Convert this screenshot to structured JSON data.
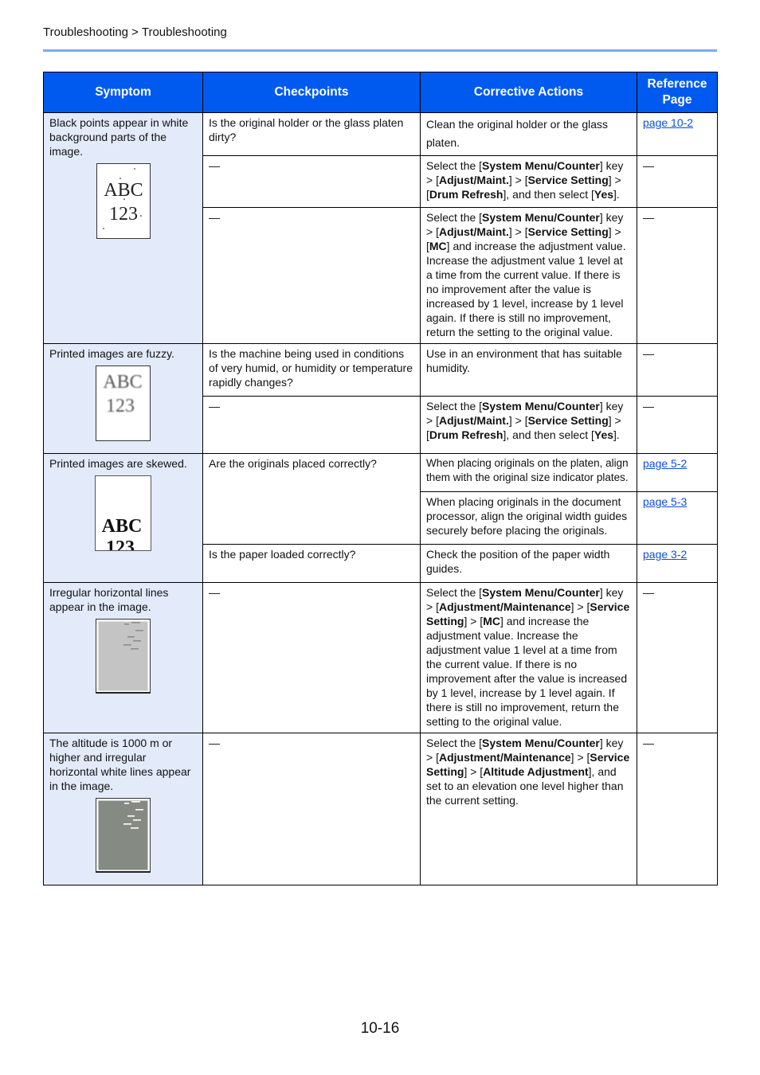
{
  "breadcrumb": "Troubleshooting > Troubleshooting",
  "colors": {
    "header": "#005af0",
    "symptom_bg": "#e3ebfb",
    "rule": "#7ea9f3",
    "link": "#0b4fe0"
  },
  "headers": [
    "Symptom",
    "Checkpoints",
    "Corrective Actions",
    "Reference Page"
  ],
  "symptoms": [
    {
      "text": "Black points appear in white background parts of the image.",
      "image": {
        "type": "black-points",
        "l1": "ABC",
        "l2": "123"
      }
    },
    {
      "text": "Printed images are fuzzy.",
      "image": {
        "type": "fuzzy",
        "l1": "ABC",
        "l2": "123"
      }
    },
    {
      "text": "Printed images are skewed.",
      "image": {
        "type": "skewed",
        "l1": "ABC",
        "l2": "123"
      }
    },
    {
      "text": "Irregular horizontal lines appear in the image.",
      "image": {
        "type": "gray-lines"
      }
    },
    {
      "text": "The altitude is 1000 m or higher and irregular horizontal white lines appear in the image.",
      "image": {
        "type": "dark-white-lines"
      }
    }
  ],
  "checkpoints": [
    "Is the original holder or the glass platen dirty?",
    "—",
    "—",
    "Is the machine being used in conditions of very humid, or humidity or temperature rapidly changes?",
    "—",
    "Are the originals placed correctly?",
    "Is the paper loaded correctly?",
    "—",
    "—"
  ],
  "actions": [
    [
      {
        "t": "Clean the original holder or the glass platen."
      }
    ],
    [
      {
        "t": "Select the ["
      },
      {
        "t": "System Menu/Counter",
        "b": true
      },
      {
        "t": "] key > ["
      },
      {
        "t": "Adjust/Maint.",
        "b": true
      },
      {
        "t": "] > ["
      },
      {
        "t": "Service Setting",
        "b": true
      },
      {
        "t": "] > ["
      },
      {
        "t": "Drum Refresh",
        "b": true
      },
      {
        "t": "], and then select ["
      },
      {
        "t": "Yes",
        "b": true
      },
      {
        "t": "]."
      }
    ],
    [
      {
        "t": "Select the ["
      },
      {
        "t": "System Menu/Counter",
        "b": true
      },
      {
        "t": "] key > ["
      },
      {
        "t": "Adjust/Maint.",
        "b": true
      },
      {
        "t": "] > ["
      },
      {
        "t": "Service Setting",
        "b": true
      },
      {
        "t": "] > ["
      },
      {
        "t": "MC",
        "b": true
      },
      {
        "t": "] and increase the adjustment value. Increase the adjustment value 1 level at a time from the current value. If there is no improvement after the value is increased by 1 level, increase by 1 level again. If there is still no improvement, return the setting to the original value."
      }
    ],
    [
      {
        "t": "Use in an environment that has suitable humidity."
      }
    ],
    [
      {
        "t": "Select the ["
      },
      {
        "t": "System Menu/Counter",
        "b": true
      },
      {
        "t": "] key > ["
      },
      {
        "t": "Adjust/Maint.",
        "b": true
      },
      {
        "t": "] > ["
      },
      {
        "t": "Service Setting",
        "b": true
      },
      {
        "t": "] > ["
      },
      {
        "t": "Drum Refresh",
        "b": true
      },
      {
        "t": "], and then select ["
      },
      {
        "t": "Yes",
        "b": true
      },
      {
        "t": "]."
      }
    ],
    [
      {
        "t": "When placing originals on the platen, align them with the original size indicator plates."
      }
    ],
    [
      {
        "t": "When placing originals in the document processor, align the original width guides securely before placing the originals."
      }
    ],
    [
      {
        "t": "Check the position of the paper width guides."
      }
    ],
    [
      {
        "t": "Select the ["
      },
      {
        "t": "System Menu/Counter",
        "b": true
      },
      {
        "t": "] key > ["
      },
      {
        "t": "Adjustment/Maintenance",
        "b": true
      },
      {
        "t": "] > ["
      },
      {
        "t": "Service Setting",
        "b": true
      },
      {
        "t": "] > ["
      },
      {
        "t": "MC",
        "b": true
      },
      {
        "t": "] and increase the adjustment value. Increase the adjustment value 1 level at a time from the current value. If there is no improvement after the value is increased by 1 level, increase by 1 level again. If there is still no improvement, return the setting to the original value."
      }
    ],
    [
      {
        "t": "Select the ["
      },
      {
        "t": "System Menu/Counter",
        "b": true
      },
      {
        "t": "] key > ["
      },
      {
        "t": "Adjustment/Maintenance",
        "b": true
      },
      {
        "t": "] > ["
      },
      {
        "t": "Service Setting",
        "b": true
      },
      {
        "t": "] > ["
      },
      {
        "t": "Altitude Adjustment",
        "b": true
      },
      {
        "t": "], and set to an elevation one level higher than the current setting."
      }
    ]
  ],
  "refs": [
    "page 10-2",
    "—",
    "—",
    "—",
    "—",
    "page 5-2",
    "page 5-3",
    "page 3-2",
    "—",
    "—"
  ],
  "page_number": "10-16"
}
